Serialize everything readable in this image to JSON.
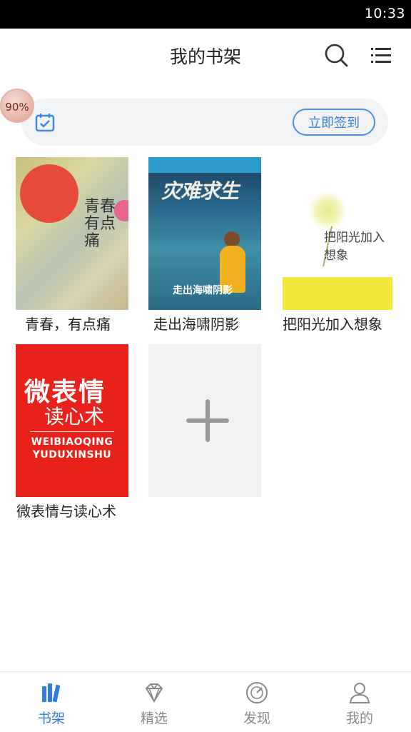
{
  "status": {
    "time": "10:33"
  },
  "header": {
    "title": "我的书架"
  },
  "sign": {
    "button_label": "立即签到",
    "progress_label": "90%"
  },
  "books": [
    {
      "title": "青春，有点痛",
      "cover_text": "青春有点痛"
    },
    {
      "title": "走出海啸阴影",
      "cover_text": "灾难求生",
      "cover_sub": "走出海啸阴影"
    },
    {
      "title": "把阳光加入想象",
      "cover_text": "把阳光加入想象"
    },
    {
      "title": "微表情与读心术",
      "cover_text": "微表情",
      "cover_sub": "读心术",
      "cover_en": "WEIBIAOQING YUDUXINSHU"
    }
  ],
  "tabs": [
    {
      "label": "书架",
      "icon": "bookshelf-icon",
      "active": true
    },
    {
      "label": "精选",
      "icon": "diamond-icon",
      "active": false
    },
    {
      "label": "发现",
      "icon": "compass-icon",
      "active": false
    },
    {
      "label": "我的",
      "icon": "user-icon",
      "active": false
    }
  ],
  "colors": {
    "accent": "#2f7be0",
    "signbar_bg": "#f2f3f5"
  }
}
